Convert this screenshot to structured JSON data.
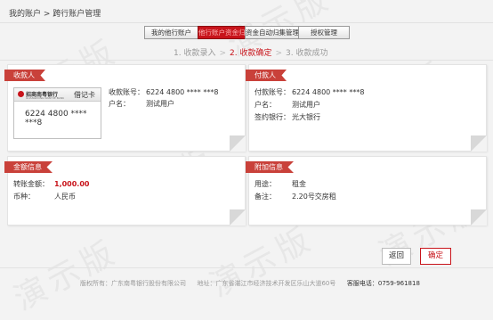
{
  "breadcrumb": {
    "root": "我的账户",
    "sep": " > ",
    "current": "跨行账户管理"
  },
  "tabs": [
    {
      "label": "我的他行账户"
    },
    {
      "label": "他行账户资金归集"
    },
    {
      "label": "资金自动归集管理"
    },
    {
      "label": "授权管理"
    }
  ],
  "steps": [
    {
      "label": "1. 收款录入"
    },
    {
      "label": "2. 收款确定"
    },
    {
      "label": "3. 收款成功"
    }
  ],
  "payee": {
    "title": "收款人",
    "card": {
      "bank": "招商南粤银行",
      "bank_en": "GUANGDONG NANYUE BANK",
      "type": "借记卡",
      "number": "6224 4800 **** ***8"
    },
    "account_label": "收款账号：",
    "account_value": "6224 4800 **** ***8",
    "name_label": "户名：",
    "name_value": "测试用户"
  },
  "payer": {
    "title": "付款人",
    "account_label": "付款账号：",
    "account_value": "6224 4800 **** ***8",
    "name_label": "户名：",
    "name_value": "测试用户",
    "bank_label": "签约银行：",
    "bank_value": "光大银行"
  },
  "amount_info": {
    "title": "金额信息",
    "amount_label": "转账金额：",
    "amount_value": "1,000.00",
    "currency_label": "币种：",
    "currency_value": "人民币"
  },
  "extra_info": {
    "title": "附加信息",
    "purpose_label": "用途：",
    "purpose_value": "租金",
    "note_label": "备注：",
    "note_value": "2.20号交房租"
  },
  "buttons": {
    "back": "返回",
    "confirm": "确定"
  },
  "footer": {
    "copyright": "版权所有：广东南粤银行股份有限公司",
    "address": "地址：广东省湛江市经济技术开发区乐山大道60号",
    "phone_label": "客服电话：",
    "phone": "0759-961818"
  },
  "watermark": "演示版",
  "colors": {
    "accent": "#c8141b",
    "panel_title": "#c9413a"
  }
}
